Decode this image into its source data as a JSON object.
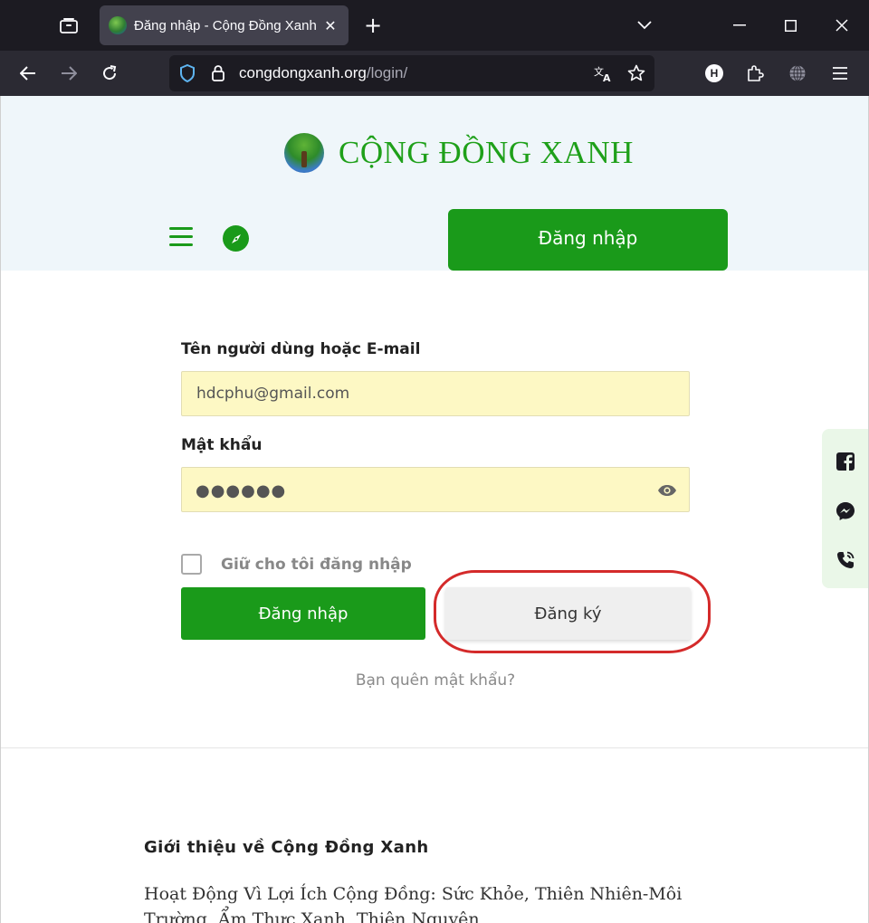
{
  "browser": {
    "tab": {
      "title": "Đăng nhập - Cộng Đồng Xanh"
    },
    "url": {
      "domain": "congdongxanh.org",
      "path": "/login/"
    },
    "profile_initial": "H"
  },
  "site": {
    "logo_text": "CỘNG ĐỒNG XANH",
    "header_login_label": "Đăng nhập"
  },
  "login_form": {
    "username_label": "Tên người dùng hoặc E-mail",
    "username_value": "hdcphu@gmail.com",
    "password_label": "Mật khẩu",
    "password_mask": "●●●●●●",
    "remember_label": "Giữ cho tôi đăng nhập",
    "remember_checked": false,
    "submit_label": "Đăng nhập",
    "register_label": "Đăng ký",
    "forgot_label": "Bạn quên mật khẩu?"
  },
  "intro": {
    "title": "Giới thiệu về Cộng Đồng Xanh",
    "text": "Hoạt Động Vì Lợi Ích Cộng Đồng: Sức Khỏe, Thiên Nhiên-Môi Trường, Ẩm Thực Xanh, Thiện Nguyện"
  },
  "colors": {
    "brand_green": "#1a9a1a",
    "highlight_red": "#d42a2a",
    "autofill_yellow": "#fdf8c4"
  },
  "icons": [
    "tab-list-icon",
    "close-icon",
    "plus-icon",
    "chevron-down-icon",
    "minimize-icon",
    "maximize-icon",
    "window-close-icon",
    "back-icon",
    "forward-icon",
    "reload-icon",
    "shield-icon",
    "lock-icon",
    "translate-icon",
    "star-icon",
    "extensions-icon",
    "globe-icon",
    "app-menu-icon",
    "hamburger-icon",
    "compass-icon",
    "eye-icon",
    "facebook-icon",
    "messenger-icon",
    "phone-icon"
  ]
}
